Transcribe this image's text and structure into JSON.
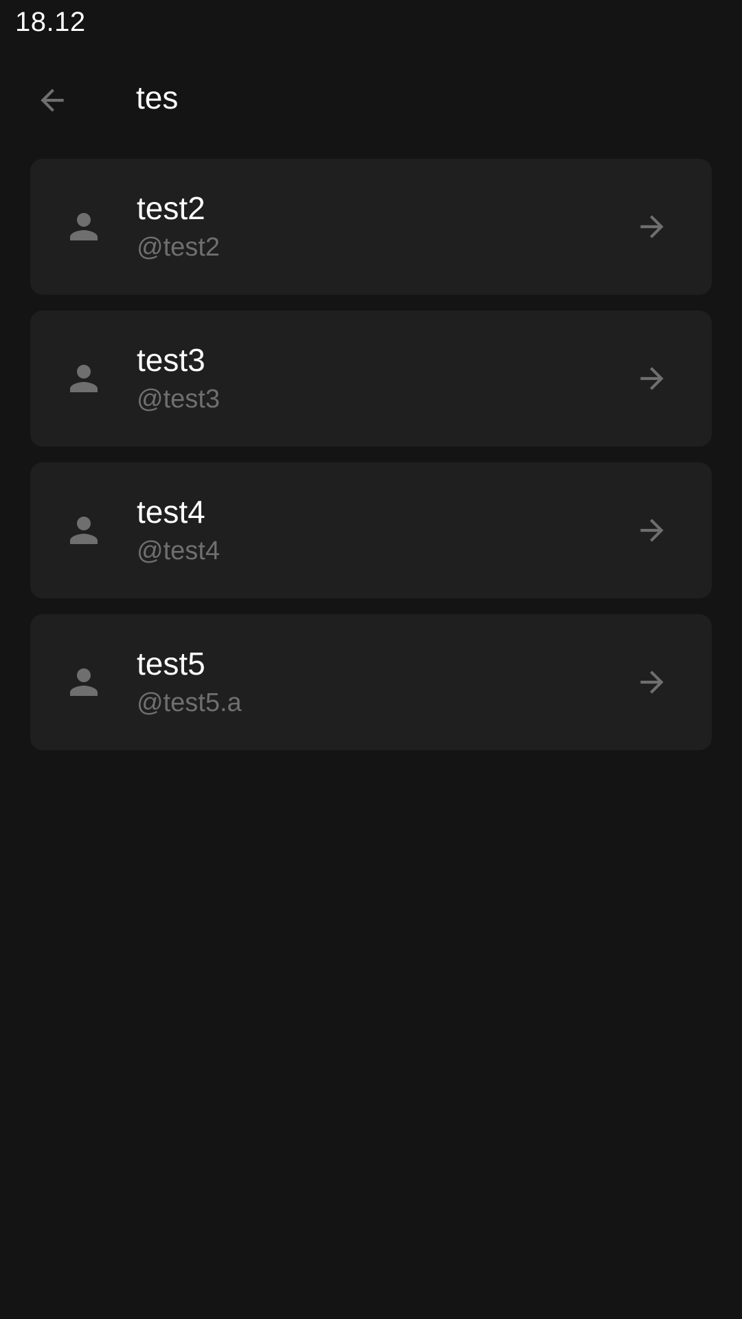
{
  "status_bar": {
    "time": "18.12"
  },
  "app_bar": {
    "back_icon": "arrow-left-icon",
    "query": "tes"
  },
  "results": [
    {
      "name": "test2",
      "handle": "@test2"
    },
    {
      "name": "test3",
      "handle": "@test3"
    },
    {
      "name": "test4",
      "handle": "@test4"
    },
    {
      "name": "test5",
      "handle": "@test5.a"
    }
  ],
  "icons": {
    "avatar": "person-icon",
    "open": "arrow-right-icon"
  },
  "colors": {
    "background": "#141414",
    "card": "#1f1f1f",
    "text_primary": "#ffffff",
    "text_secondary": "#6f6f6f",
    "icon": "#6f6f6f"
  }
}
